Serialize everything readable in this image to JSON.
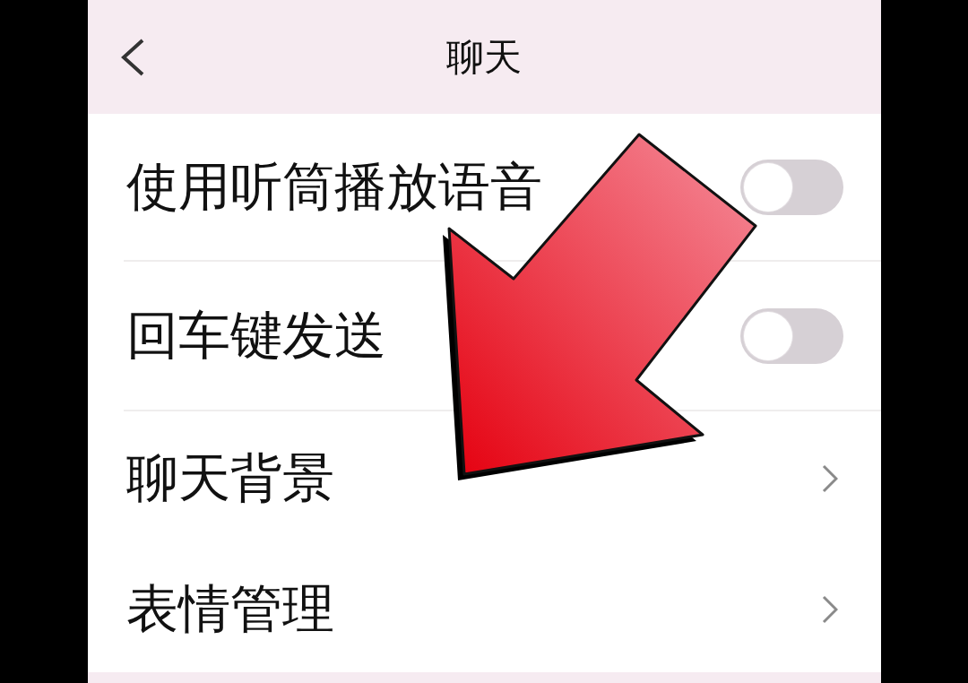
{
  "header": {
    "title": "聊天"
  },
  "settings": [
    {
      "kind": "toggle",
      "label": "使用听筒播放语音",
      "on": false
    },
    {
      "kind": "toggle",
      "label": "回车键发送",
      "on": false
    },
    {
      "kind": "link",
      "label": "聊天背景"
    },
    {
      "kind": "link",
      "label": "表情管理"
    }
  ],
  "overlay": {
    "kind": "arrow"
  }
}
